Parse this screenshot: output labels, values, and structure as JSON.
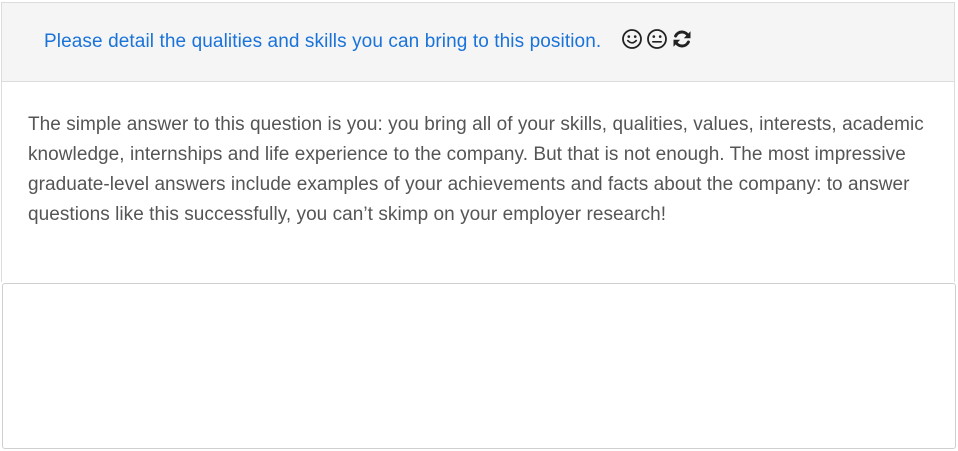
{
  "question": {
    "text": "Please detail the qualities and skills you can bring to this position."
  },
  "icons": {
    "happy": "smiley-face-icon",
    "neutral": "neutral-face-icon",
    "refresh": "refresh-icon"
  },
  "answer": {
    "text": "The simple answer to this question is you: you bring all of your skills, qualities, values, interests, academic knowledge, internships and life experience to the company. But that is not enough. The most impressive graduate-level answers include examples of your achievements and facts about the company: to answer questions like this successfully, you can’t skimp on your employer research!"
  },
  "response": {
    "value": "",
    "placeholder": ""
  },
  "colors": {
    "question": "#1a73d9",
    "header_bg": "#f5f5f5",
    "body_text": "#555555"
  }
}
